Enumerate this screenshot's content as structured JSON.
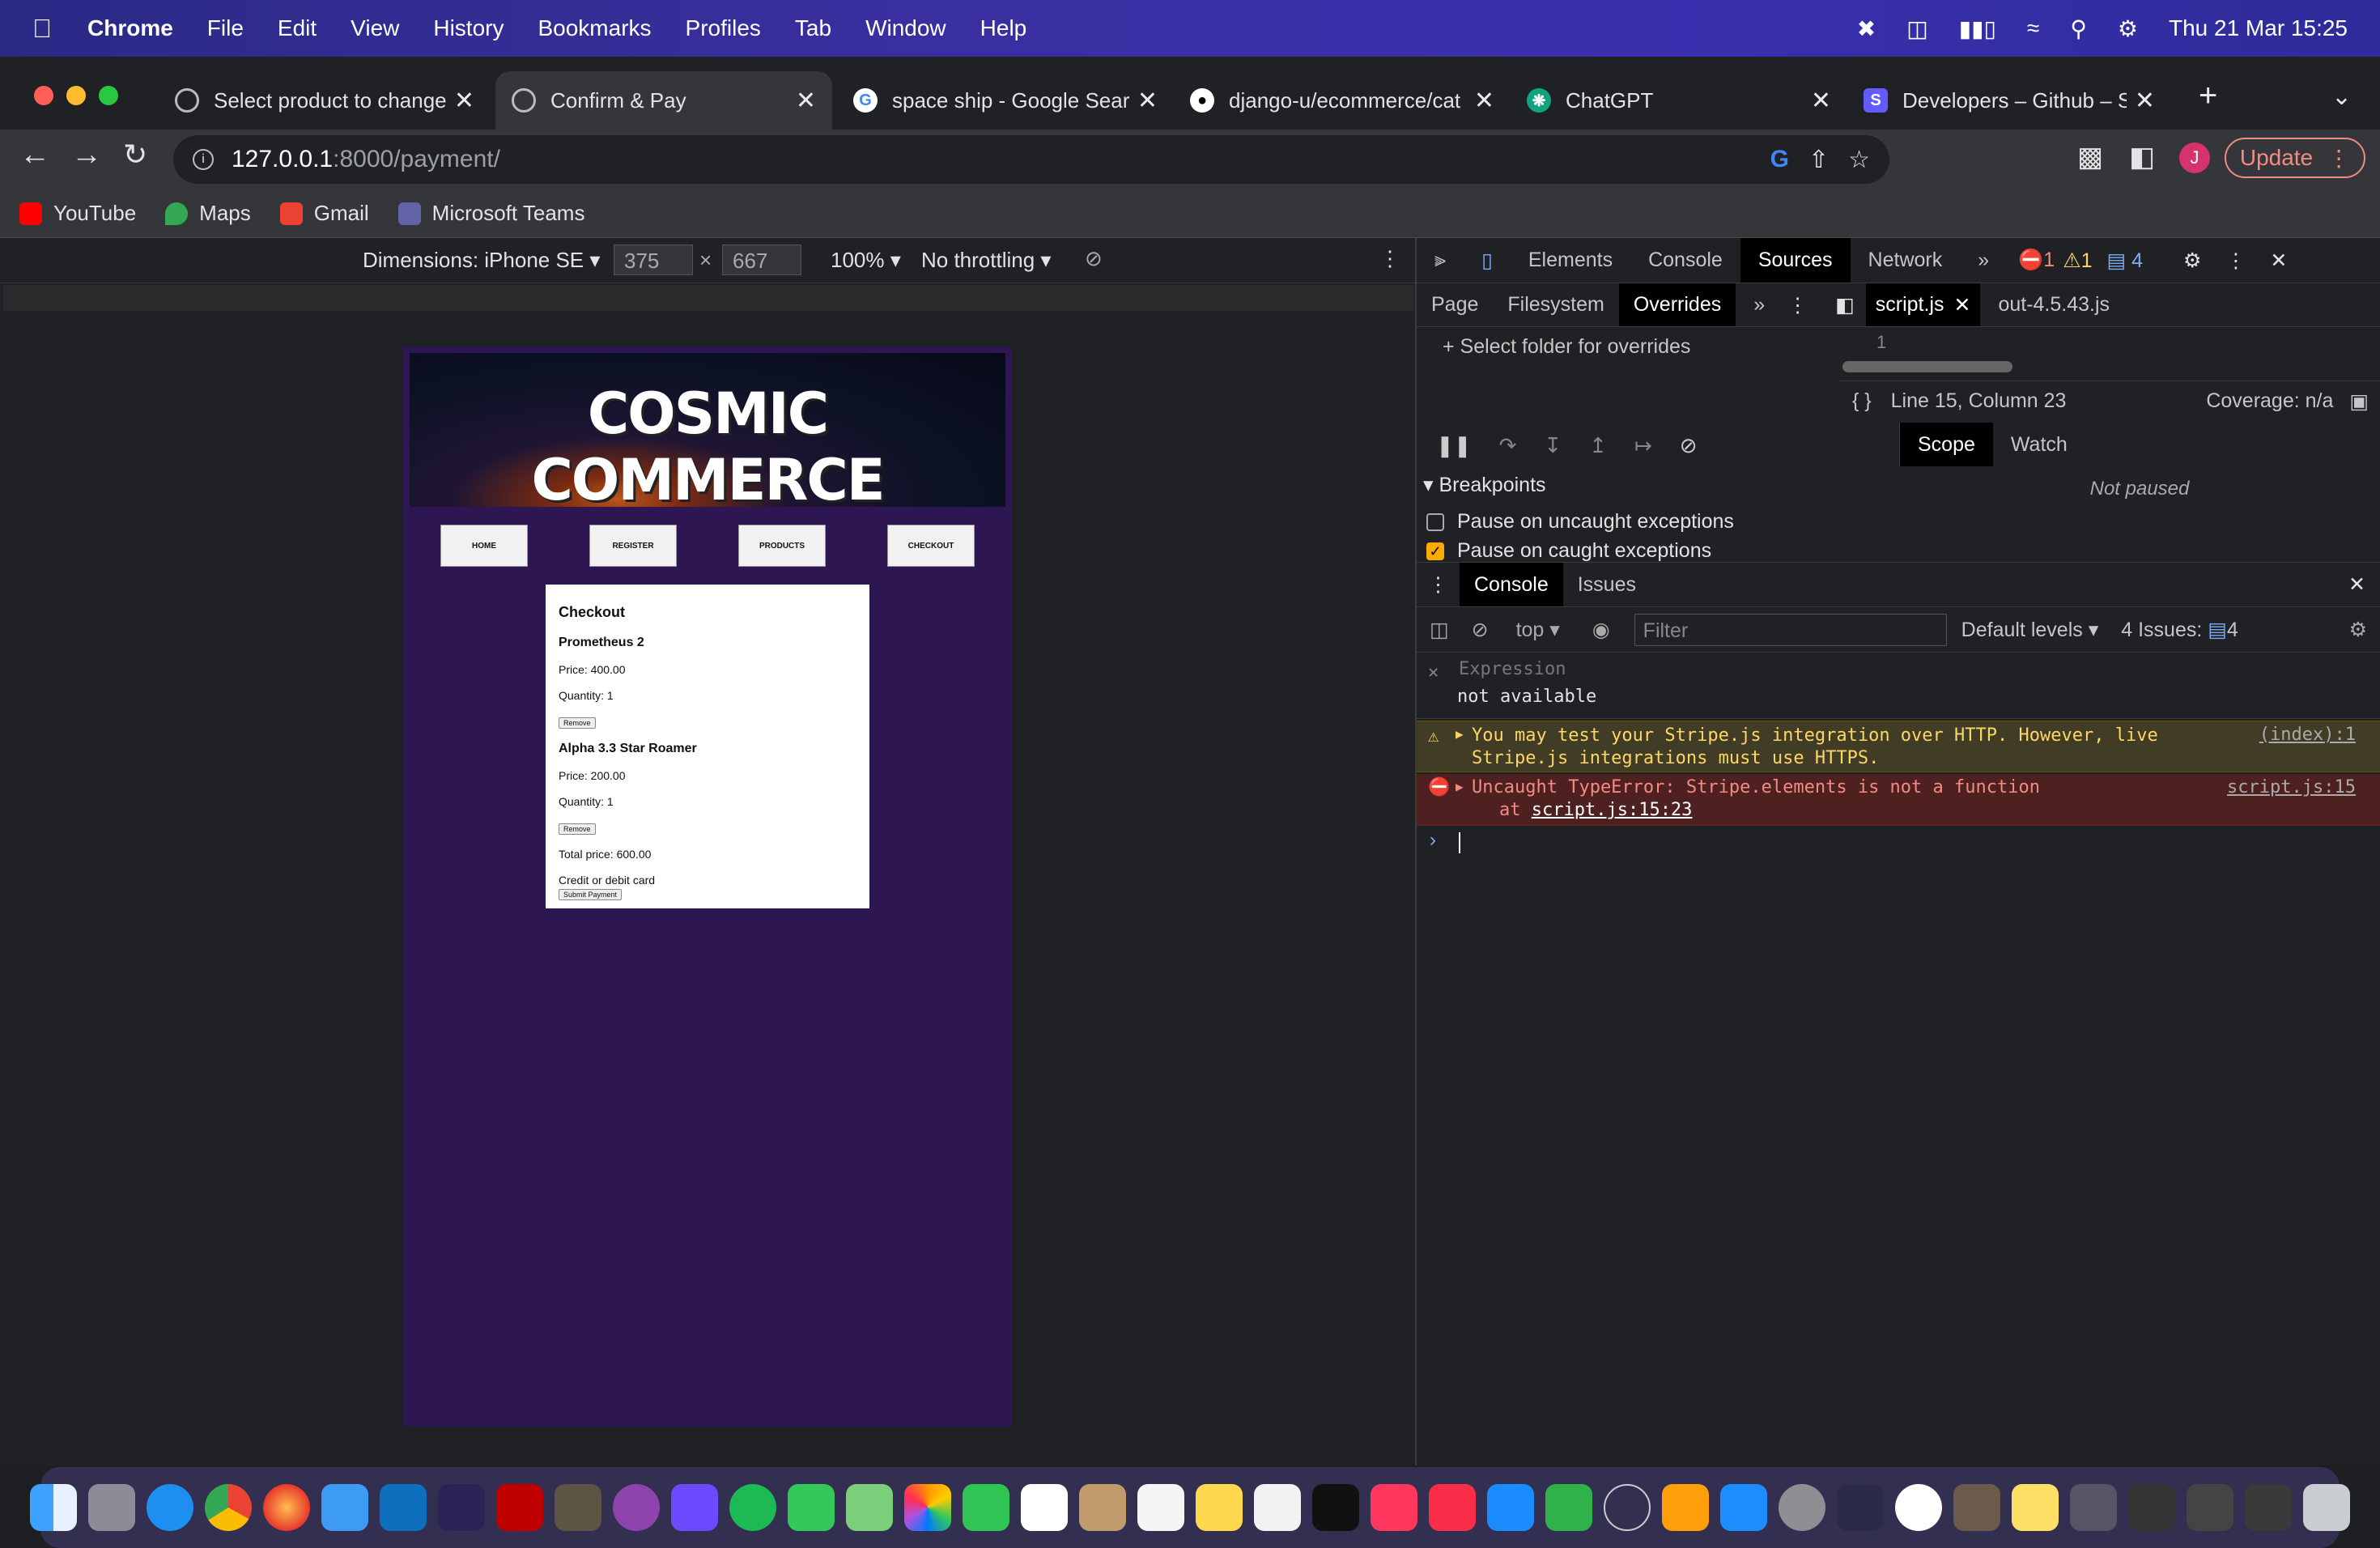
{
  "menubar": {
    "app": "Chrome",
    "items": [
      "File",
      "Edit",
      "View",
      "History",
      "Bookmarks",
      "Profiles",
      "Tab",
      "Window",
      "Help"
    ],
    "datetime": "Thu 21 Mar  15:25"
  },
  "tabs": [
    {
      "title": "Select product to change",
      "icon": "globe-icon",
      "active": false
    },
    {
      "title": "Confirm & Pay",
      "icon": "globe-icon",
      "active": true
    },
    {
      "title": "space ship - Google Search",
      "icon": "google-icon",
      "active": false
    },
    {
      "title": "django-u/ecommerce/cat",
      "icon": "github-icon",
      "active": false
    },
    {
      "title": "ChatGPT",
      "icon": "chatgpt-icon",
      "active": false
    },
    {
      "title": "Developers – Github – Str",
      "icon": "stripe-icon",
      "active": false
    }
  ],
  "toolbar": {
    "url_host": "127.0.0.1",
    "url_rest": ":8000/payment/",
    "update_label": "Update",
    "avatar_letter": "J"
  },
  "bookmarks": [
    {
      "label": "YouTube",
      "color": "#ff0000"
    },
    {
      "label": "Maps",
      "color": "#34a853"
    },
    {
      "label": "Gmail",
      "color": "#ea4335"
    },
    {
      "label": "Microsoft Teams",
      "color": "#6264a7"
    }
  ],
  "device": {
    "dimensions": "Dimensions: iPhone SE",
    "width": "375",
    "height": "667",
    "zoom": "100%",
    "throttling": "No throttling"
  },
  "site": {
    "title": "COSMIC COMMERCE",
    "nav": [
      "HOME",
      "REGISTER",
      "PRODUCTS",
      "CHECKOUT"
    ],
    "checkout": {
      "heading": "Checkout",
      "items": [
        {
          "name": "Prometheus 2",
          "price": "Price: 400.00",
          "qty": "Quantity: 1",
          "remove": "Remove"
        },
        {
          "name": "Alpha 3.3 Star Roamer",
          "price": "Price: 200.00",
          "qty": "Quantity: 1",
          "remove": "Remove"
        }
      ],
      "total": "Total price: 600.00",
      "card_label": "Credit or debit card",
      "submit": "Submit Payment"
    }
  },
  "devtools": {
    "tabs": [
      "Elements",
      "Console",
      "Sources",
      "Network"
    ],
    "active_tab": "Sources",
    "errors": "1",
    "warnings": "1",
    "messages": "4",
    "sources_tabs": [
      "Page",
      "Filesystem",
      "Overrides"
    ],
    "overrides_action": "Select folder for overrides",
    "files": [
      "script.js",
      "out-4.5.43.js"
    ],
    "line_no": "1",
    "cursor_pos": "Line 15, Column 23",
    "coverage": "Coverage: n/a",
    "breakpoints_label": "Breakpoints",
    "pause_uncaught": "Pause on uncaught exceptions",
    "pause_caught": "Pause on caught exceptions",
    "scope_tabs": [
      "Scope",
      "Watch"
    ],
    "not_paused": "Not paused",
    "drawer_tabs": [
      "Console",
      "Issues"
    ],
    "context": "top",
    "filter_placeholder": "Filter",
    "levels": "Default levels",
    "issues": "4 Issues:",
    "issues_count": "4",
    "expression_label": "Expression",
    "expression_value": "not available",
    "warning_text": "You may test your Stripe.js integration over HTTP. However, live Stripe.js integrations must use HTTPS.",
    "warning_link": "(index):1",
    "error_text": "Uncaught TypeError: Stripe.elements is not a function",
    "error_at": "at ",
    "error_at_link": "script.js:15:23",
    "error_link": "script.js:15"
  }
}
